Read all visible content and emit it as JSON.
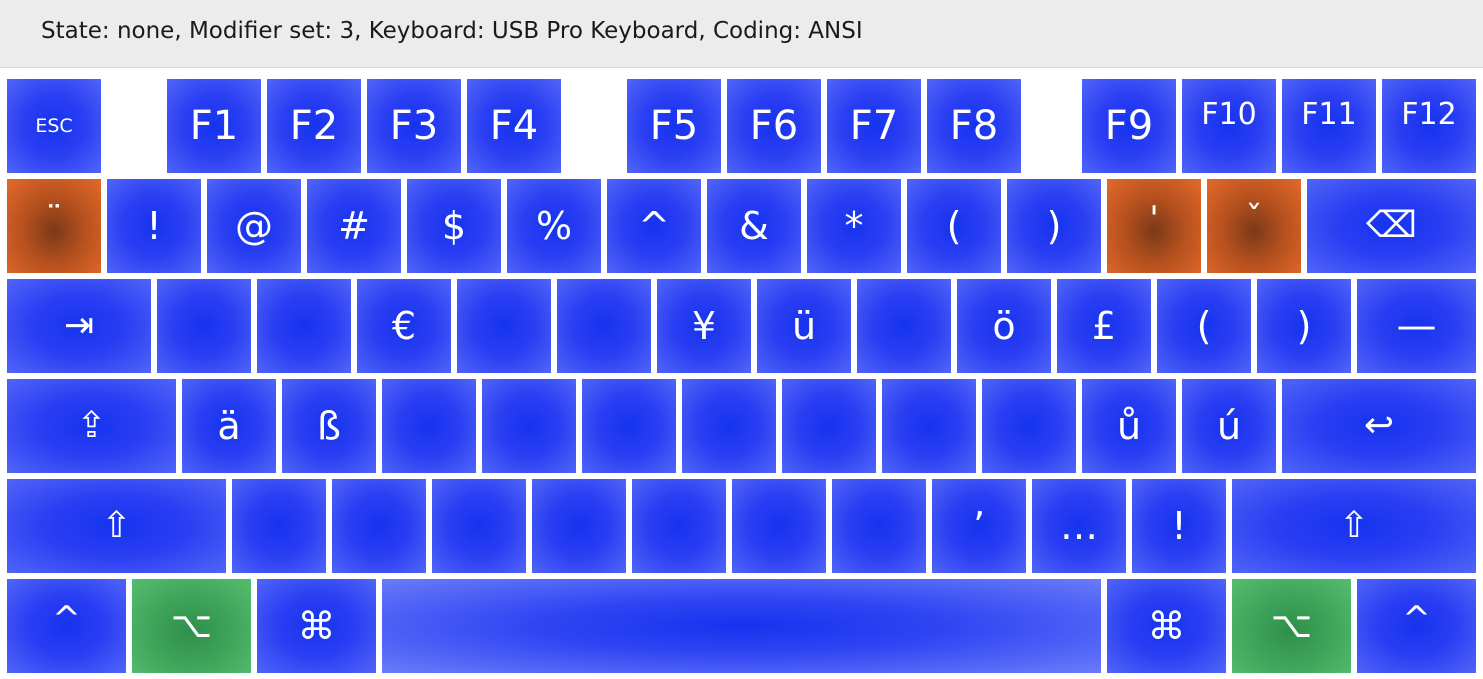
{
  "status": {
    "text": "State: none, Modifier set: 3, Keyboard: USB Pro Keyboard, Coding: ANSI"
  },
  "keyboard": {
    "function_row": [
      {
        "name": "esc",
        "label": "ESC"
      },
      {
        "name": "f1",
        "label": "F1"
      },
      {
        "name": "f2",
        "label": "F2"
      },
      {
        "name": "f3",
        "label": "F3"
      },
      {
        "name": "f4",
        "label": "F4"
      },
      {
        "name": "f5",
        "label": "F5"
      },
      {
        "name": "f6",
        "label": "F6"
      },
      {
        "name": "f7",
        "label": "F7"
      },
      {
        "name": "f8",
        "label": "F8"
      },
      {
        "name": "f9",
        "label": "F9"
      },
      {
        "name": "f10",
        "label": "F10"
      },
      {
        "name": "f11",
        "label": "F11"
      },
      {
        "name": "f12",
        "label": "F12"
      }
    ],
    "number_row": [
      {
        "name": "diaeresis",
        "label": "¨",
        "dead": true
      },
      {
        "name": "exclamation",
        "label": "!"
      },
      {
        "name": "at",
        "label": "@"
      },
      {
        "name": "hash",
        "label": "#"
      },
      {
        "name": "dollar",
        "label": "$"
      },
      {
        "name": "percent",
        "label": "%"
      },
      {
        "name": "caret",
        "label": "^"
      },
      {
        "name": "ampersand",
        "label": "&"
      },
      {
        "name": "asterisk",
        "label": "*"
      },
      {
        "name": "paren-open",
        "label": "("
      },
      {
        "name": "paren-close",
        "label": ")"
      },
      {
        "name": "acute",
        "label": "'",
        "dead": true
      },
      {
        "name": "caron",
        "label": "ˇ",
        "dead": true
      },
      {
        "name": "delete",
        "icon": "delete-backward-icon",
        "label": "⌫"
      }
    ],
    "top_row": [
      {
        "name": "tab",
        "icon": "tab-icon",
        "label": "⇥"
      },
      {
        "name": "q",
        "label": ""
      },
      {
        "name": "w",
        "label": ""
      },
      {
        "name": "e",
        "label": "€"
      },
      {
        "name": "r",
        "label": ""
      },
      {
        "name": "t",
        "label": ""
      },
      {
        "name": "y",
        "label": "¥"
      },
      {
        "name": "u",
        "label": "ü"
      },
      {
        "name": "i",
        "label": ""
      },
      {
        "name": "o",
        "label": "ö"
      },
      {
        "name": "p",
        "label": "£"
      },
      {
        "name": "bracket-open",
        "label": "("
      },
      {
        "name": "bracket-close",
        "label": ")"
      },
      {
        "name": "backslash",
        "label": "—"
      }
    ],
    "home_row": [
      {
        "name": "caps-lock",
        "icon": "caps-lock-icon",
        "label": "⇪"
      },
      {
        "name": "a",
        "label": "ä"
      },
      {
        "name": "s",
        "label": "ß"
      },
      {
        "name": "d",
        "label": ""
      },
      {
        "name": "f",
        "label": ""
      },
      {
        "name": "g",
        "label": ""
      },
      {
        "name": "h",
        "label": ""
      },
      {
        "name": "j",
        "label": ""
      },
      {
        "name": "k",
        "label": ""
      },
      {
        "name": "l",
        "label": ""
      },
      {
        "name": "semicolon",
        "label": "ů"
      },
      {
        "name": "quote",
        "label": "ú"
      },
      {
        "name": "return",
        "icon": "return-icon",
        "label": "↩"
      }
    ],
    "bottom_row": [
      {
        "name": "shift-left",
        "icon": "shift-icon",
        "label": "⇧"
      },
      {
        "name": "z",
        "label": ""
      },
      {
        "name": "x",
        "label": ""
      },
      {
        "name": "c",
        "label": ""
      },
      {
        "name": "v",
        "label": ""
      },
      {
        "name": "b",
        "label": ""
      },
      {
        "name": "n",
        "label": ""
      },
      {
        "name": "m",
        "label": ""
      },
      {
        "name": "comma",
        "label": "’"
      },
      {
        "name": "period",
        "label": "…"
      },
      {
        "name": "slash",
        "label": "!"
      },
      {
        "name": "shift-right",
        "icon": "shift-icon",
        "label": "⇧"
      }
    ],
    "modifier_row": [
      {
        "name": "control-left",
        "icon": "control-icon",
        "label": "^"
      },
      {
        "name": "option-left",
        "icon": "option-icon",
        "label": "⌥",
        "active": true
      },
      {
        "name": "command-left",
        "icon": "command-icon",
        "label": "⌘"
      },
      {
        "name": "space",
        "label": ""
      },
      {
        "name": "command-right",
        "icon": "command-icon",
        "label": "⌘"
      },
      {
        "name": "option-right",
        "icon": "option-icon",
        "label": "⌥",
        "active": true
      },
      {
        "name": "control-right",
        "icon": "control-icon",
        "label": "^"
      }
    ]
  },
  "colors": {
    "key_blue": "#2a3ef3",
    "dead_key_orange": "#e46a2a",
    "active_modifier_green": "#3ea35a",
    "status_bar_bg": "#ececec"
  }
}
